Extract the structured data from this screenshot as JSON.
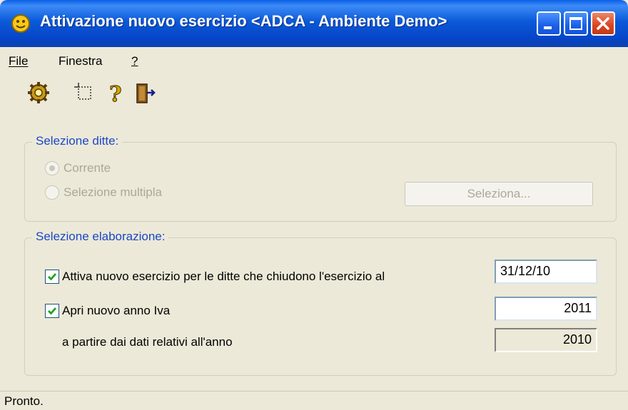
{
  "window": {
    "title": "Attivazione nuovo esercizio <ADCA - Ambiente Demo>"
  },
  "menu": {
    "file": "File",
    "finestra": "Finestra",
    "help": "?"
  },
  "toolbar": {
    "icons": [
      "gear-run-icon",
      "select-icon",
      "help-icon",
      "exit-icon"
    ]
  },
  "selezione_ditte": {
    "legend": "Selezione ditte:",
    "radio_corrente": "Corrente",
    "radio_multipla": "Selezione multipla",
    "selected": "Corrente",
    "button_seleziona": "Seleziona..."
  },
  "selezione_elaborazione": {
    "legend": "Selezione elaborazione:",
    "attiva_label": "Attiva nuovo esercizio per le ditte che chiudono l'esercizio al",
    "attiva_checked": true,
    "attiva_value": "31/12/10",
    "apri_label": "Apri nuovo anno Iva",
    "apri_checked": true,
    "apri_value": "2011",
    "partire_label": "a partire dai dati relativi all'anno",
    "partire_value": "2010"
  },
  "status": {
    "text": "Pronto."
  },
  "colors": {
    "titlebar": "#0b5ad9",
    "legend": "#1a47c8",
    "background": "#ece9d8",
    "close_button": "#d8441e"
  }
}
